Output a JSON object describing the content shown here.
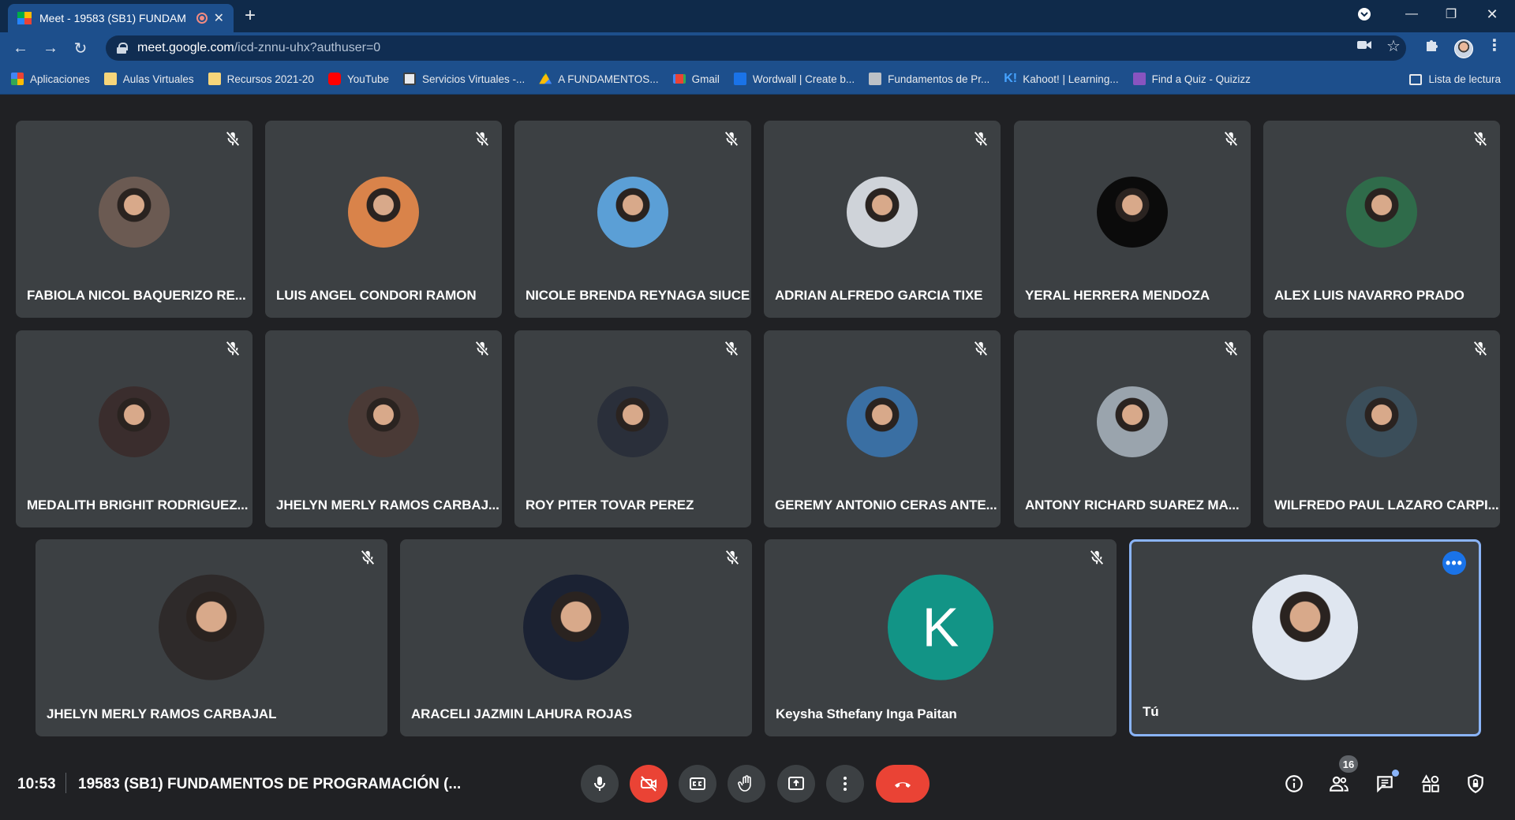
{
  "browser": {
    "tab_title": "Meet - 19583 (SB1) FUNDAM",
    "url_host": "meet.google.com",
    "url_path": "/icd-znnu-uhx?authuser=0",
    "bookmarks": [
      {
        "label": "Aplicaciones",
        "icon": "apps-grid-icon",
        "color": "#ea4335"
      },
      {
        "label": "Aulas Virtuales",
        "icon": "folder-icon",
        "color": "#f6d57a"
      },
      {
        "label": "Recursos 2021-20",
        "icon": "folder-icon",
        "color": "#f6d57a"
      },
      {
        "label": "YouTube",
        "icon": "youtube-icon",
        "color": "#ff0000"
      },
      {
        "label": "Servicios Virtuales -...",
        "icon": "site-icon",
        "color": "#e8eaed"
      },
      {
        "label": "A FUNDAMENTOS...",
        "icon": "drive-icon",
        "color": "#34a853"
      },
      {
        "label": "Gmail",
        "icon": "gmail-icon",
        "color": "#ea4335"
      },
      {
        "label": "Wordwall | Create b...",
        "icon": "wordwall-icon",
        "color": "#1a73e8"
      },
      {
        "label": "Fundamentos de Pr...",
        "icon": "site-icon",
        "color": "#bdc1c6"
      },
      {
        "label": "Kahoot! | Learning...",
        "icon": "kahoot-icon",
        "color": "#46a3ff"
      },
      {
        "label": "Find a Quiz - Quizizz",
        "icon": "quizizz-icon",
        "color": "#8854c0"
      }
    ],
    "reading_list": "Lista de lectura"
  },
  "participants": [
    {
      "name": "FABIOLA NICOL BAQUERIZO RE...",
      "bg": "#6b5a52"
    },
    {
      "name": "LUIS ANGEL CONDORI RAMON",
      "bg": "#d9834a"
    },
    {
      "name": "NICOLE BRENDA REYNAGA SIUCE",
      "bg": "#5b9fd6"
    },
    {
      "name": "ADRIAN ALFREDO GARCIA TIXE",
      "bg": "#cfd3d9"
    },
    {
      "name": "YERAL HERRERA MENDOZA",
      "bg": "#0b0b0b"
    },
    {
      "name": "ALEX LUIS NAVARRO PRADO",
      "bg": "#2f6b4a"
    },
    {
      "name": "MEDALITH BRIGHIT RODRIGUEZ...",
      "bg": "#3a2d2d"
    },
    {
      "name": "JHELYN MERLY RAMOS CARBAJ...",
      "bg": "#4a3a36"
    },
    {
      "name": "ROY PITER TOVAR PEREZ",
      "bg": "#2a2f3a"
    },
    {
      "name": "GEREMY ANTONIO CERAS ANTE...",
      "bg": "#3a6fa3"
    },
    {
      "name": "ANTONY RICHARD SUAREZ MA...",
      "bg": "#9aa4ad"
    },
    {
      "name": "WILFREDO PAUL LAZARO CARPI...",
      "bg": "#3b4e5a"
    },
    {
      "name": "JHELYN MERLY RAMOS CARBAJAL",
      "bg": "#2e2a2a"
    },
    {
      "name": "ARACELI JAZMIN LAHURA ROJAS",
      "bg": "#1b2233"
    },
    {
      "name": "Keysha Sthefany Inga Paitan",
      "letter": "K",
      "bg": "#129486"
    },
    {
      "name": "Tú",
      "bg": "#dfe6f0"
    }
  ],
  "bottom": {
    "time": "10:53",
    "meeting_title": "19583 (SB1) FUNDAMENTOS DE PROGRAMACIÓN (...",
    "participant_count": "16"
  }
}
